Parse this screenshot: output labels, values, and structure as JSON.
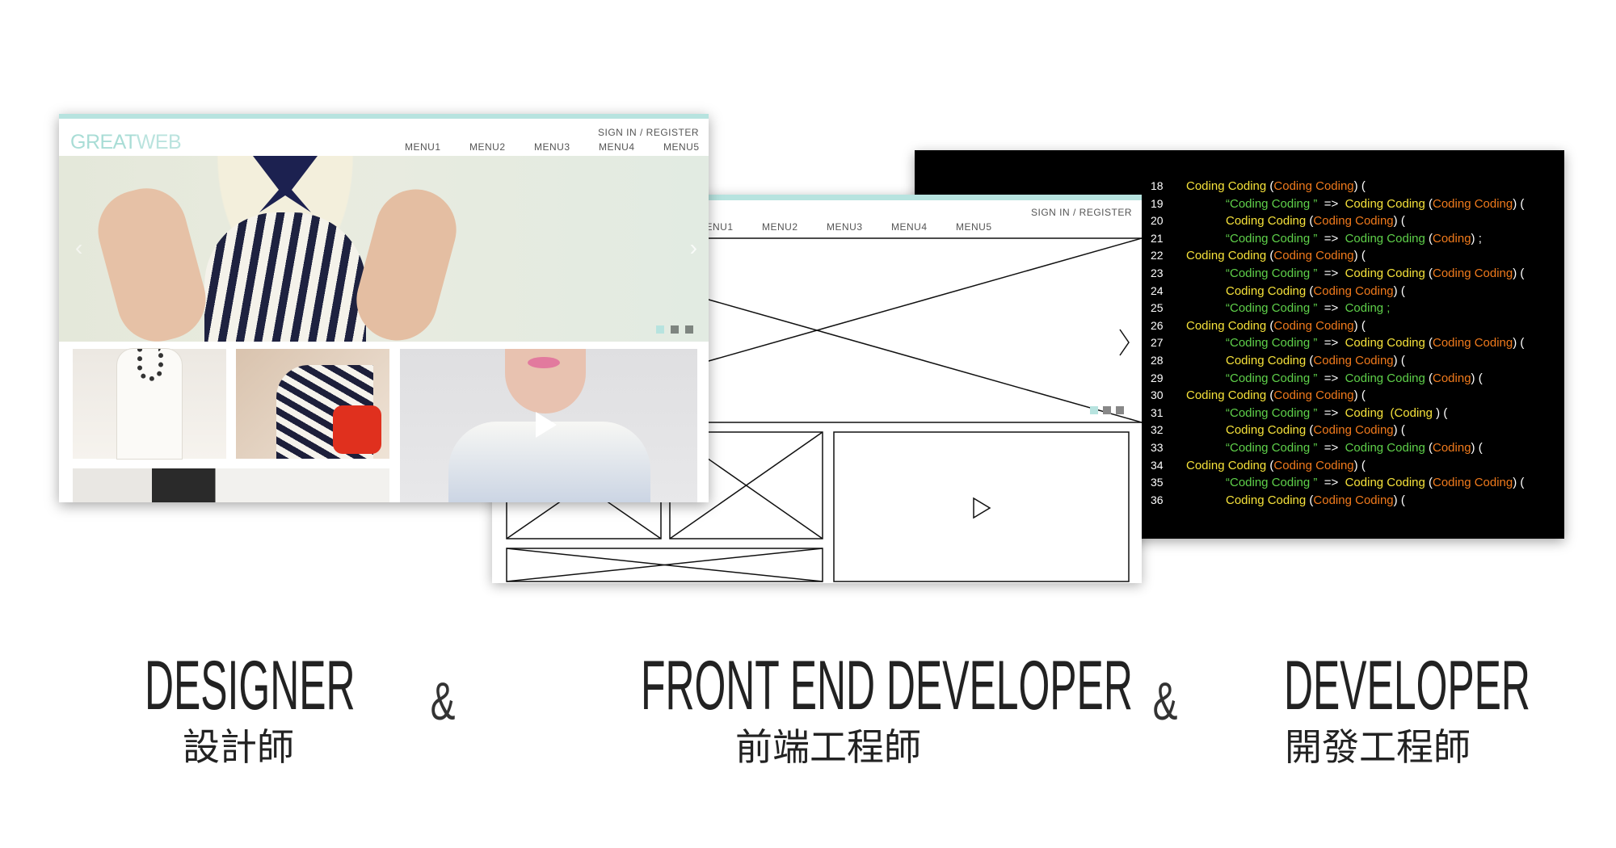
{
  "design_mockup": {
    "logo": {
      "bold": "GREAT",
      "light": "WEB"
    },
    "sign_in": "SIGN IN / REGISTER",
    "menu": [
      "MENU1",
      "MENU2",
      "MENU3",
      "MENU4",
      "MENU5"
    ],
    "accent": "#b7e3df",
    "slider_dots": 3
  },
  "wireframe": {
    "sign_in": "SIGN IN / REGISTER",
    "menu": [
      "MENU1",
      "MENU2",
      "MENU3",
      "MENU4",
      "MENU5"
    ]
  },
  "code": {
    "colors": {
      "keyword": "#f6e23a",
      "argument": "#f07a1c",
      "string": "#5fd14a"
    },
    "lines": [
      {
        "n": "18",
        "indent": false,
        "tokens": [
          [
            "y",
            "Coding Coding "
          ],
          [
            "w",
            "("
          ],
          [
            "o",
            "Coding Coding"
          ],
          [
            "w",
            ") ("
          ]
        ]
      },
      {
        "n": "19",
        "indent": true,
        "tokens": [
          [
            "g",
            "“Coding Coding ” "
          ],
          [
            "w",
            " =>  "
          ],
          [
            "y",
            "Coding Coding "
          ],
          [
            "w",
            "("
          ],
          [
            "o",
            "Coding Coding"
          ],
          [
            "w",
            ") ("
          ]
        ]
      },
      {
        "n": "20",
        "indent": true,
        "tokens": [
          [
            "y",
            "Coding Coding "
          ],
          [
            "w",
            "("
          ],
          [
            "o",
            "Coding Coding"
          ],
          [
            "w",
            ") ("
          ]
        ]
      },
      {
        "n": "21",
        "indent": true,
        "tokens": [
          [
            "g",
            "“Coding Coding ” "
          ],
          [
            "w",
            " =>  "
          ],
          [
            "g",
            "Coding Coding "
          ],
          [
            "w",
            "("
          ],
          [
            "o",
            "Coding"
          ],
          [
            "w",
            ") ;"
          ]
        ]
      },
      {
        "n": "22",
        "indent": false,
        "tokens": [
          [
            "y",
            "Coding Coding "
          ],
          [
            "w",
            "("
          ],
          [
            "o",
            "Coding Coding"
          ],
          [
            "w",
            ") ("
          ]
        ]
      },
      {
        "n": "23",
        "indent": true,
        "tokens": [
          [
            "g",
            "“Coding Coding ” "
          ],
          [
            "w",
            " =>  "
          ],
          [
            "y",
            "Coding Coding "
          ],
          [
            "w",
            "("
          ],
          [
            "o",
            "Coding Coding"
          ],
          [
            "w",
            ") ("
          ]
        ]
      },
      {
        "n": "24",
        "indent": true,
        "tokens": [
          [
            "y",
            "Coding Coding "
          ],
          [
            "w",
            "("
          ],
          [
            "o",
            "Coding Coding"
          ],
          [
            "w",
            ") ("
          ]
        ]
      },
      {
        "n": "25",
        "indent": true,
        "tokens": [
          [
            "g",
            "“Coding Coding ” "
          ],
          [
            "w",
            " =>  "
          ],
          [
            "g",
            "Coding ;"
          ]
        ]
      },
      {
        "n": "26",
        "indent": false,
        "tokens": [
          [
            "y",
            "Coding Coding "
          ],
          [
            "w",
            "("
          ],
          [
            "o",
            "Coding Coding"
          ],
          [
            "w",
            ") ("
          ]
        ]
      },
      {
        "n": "27",
        "indent": true,
        "tokens": [
          [
            "g",
            "“Coding Coding ” "
          ],
          [
            "w",
            " =>  "
          ],
          [
            "y",
            "Coding Coding "
          ],
          [
            "w",
            "("
          ],
          [
            "o",
            "Coding Coding"
          ],
          [
            "w",
            ") ("
          ]
        ]
      },
      {
        "n": "28",
        "indent": true,
        "tokens": [
          [
            "y",
            "Coding Coding "
          ],
          [
            "w",
            "("
          ],
          [
            "o",
            "Coding Coding"
          ],
          [
            "w",
            ") ("
          ]
        ]
      },
      {
        "n": "29",
        "indent": true,
        "tokens": [
          [
            "g",
            "“Coding Coding ” "
          ],
          [
            "w",
            " =>  "
          ],
          [
            "g",
            "Coding Coding "
          ],
          [
            "w",
            "("
          ],
          [
            "o",
            "Coding"
          ],
          [
            "w",
            ") ("
          ]
        ]
      },
      {
        "n": "30",
        "indent": false,
        "tokens": [
          [
            "y",
            "Coding Coding "
          ],
          [
            "w",
            "("
          ],
          [
            "o",
            "Coding Coding"
          ],
          [
            "w",
            ") ("
          ]
        ]
      },
      {
        "n": "31",
        "indent": true,
        "tokens": [
          [
            "g",
            "“Coding Coding ” "
          ],
          [
            "w",
            " =>  "
          ],
          [
            "y",
            "Coding  (Coding "
          ],
          [
            "w",
            ") ("
          ]
        ]
      },
      {
        "n": "32",
        "indent": true,
        "tokens": [
          [
            "y",
            "Coding Coding "
          ],
          [
            "w",
            "("
          ],
          [
            "o",
            "Coding Coding"
          ],
          [
            "w",
            ") ("
          ]
        ]
      },
      {
        "n": "33",
        "indent": true,
        "tokens": [
          [
            "g",
            "“Coding Coding ” "
          ],
          [
            "w",
            " =>  "
          ],
          [
            "g",
            "Coding Coding "
          ],
          [
            "w",
            "("
          ],
          [
            "o",
            "Coding"
          ],
          [
            "w",
            ") ("
          ]
        ]
      },
      {
        "n": "34",
        "indent": false,
        "tokens": [
          [
            "y",
            "Coding Coding "
          ],
          [
            "w",
            "("
          ],
          [
            "o",
            "Coding Coding"
          ],
          [
            "w",
            ") ("
          ]
        ]
      },
      {
        "n": "35",
        "indent": true,
        "tokens": [
          [
            "g",
            "“Coding Coding ” "
          ],
          [
            "w",
            " =>  "
          ],
          [
            "y",
            "Coding Coding "
          ],
          [
            "w",
            "("
          ],
          [
            "o",
            "Coding Coding"
          ],
          [
            "w",
            ") ("
          ]
        ]
      },
      {
        "n": "36",
        "indent": true,
        "tokens": [
          [
            "y",
            "Coding Coding "
          ],
          [
            "w",
            "("
          ],
          [
            "o",
            "Coding Coding"
          ],
          [
            "w",
            ") ("
          ]
        ]
      }
    ]
  },
  "roles": [
    {
      "title": "DESIGNER",
      "chinese": "設計師"
    },
    {
      "title": "FRONT END DEVELOPER",
      "chinese": "前端工程師"
    },
    {
      "title": "DEVELOPER",
      "chinese": "開發工程師"
    }
  ],
  "ampersand": "&"
}
